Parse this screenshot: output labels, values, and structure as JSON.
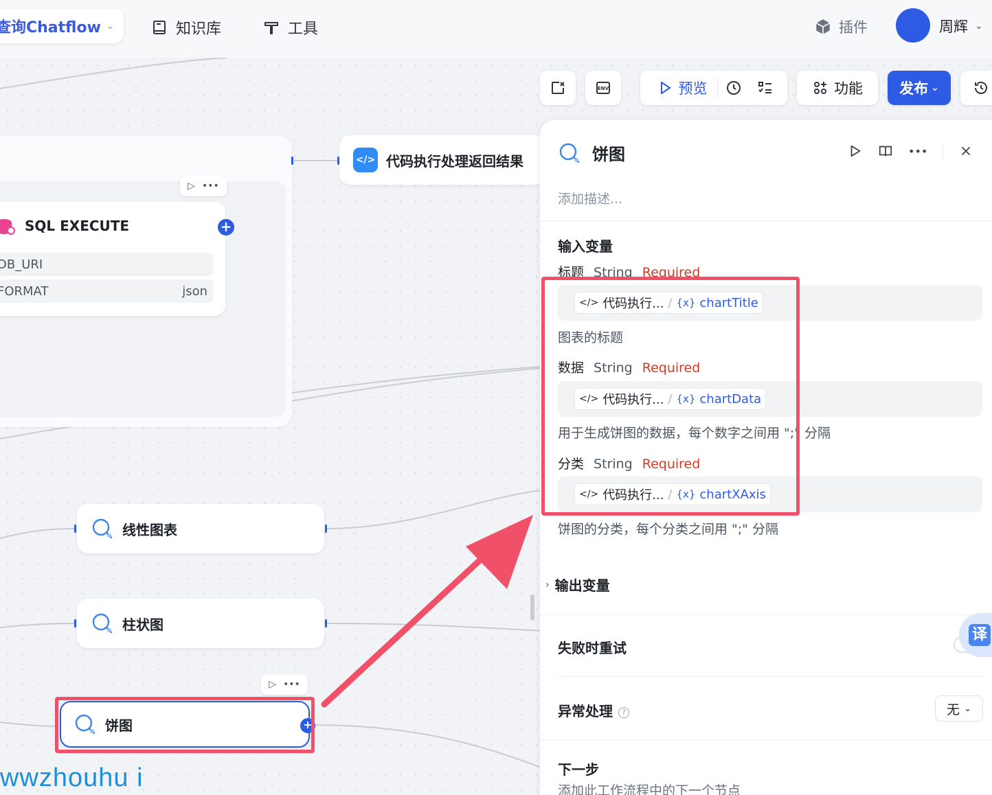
{
  "header": {
    "app_title": "查询Chatflow",
    "nav": [
      {
        "label": "知识库",
        "icon": "book-icon"
      },
      {
        "label": "工具",
        "icon": "tool-icon"
      }
    ],
    "plugins_label": "插件",
    "user_name": "周辉"
  },
  "toolbar": {
    "preview_label": "预览",
    "function_label": "功能",
    "publish_label": "发布"
  },
  "canvas": {
    "sql_node": {
      "title": "SQL EXECUTE",
      "params": [
        {
          "name": "DB_URI",
          "value": ""
        },
        {
          "name": "FORMAT",
          "value": "json"
        }
      ]
    },
    "code_node_title": "代码执行处理返回结果",
    "line_chart_title": "线性图表",
    "bar_chart_title": "柱状图",
    "pie_chart_title": "饼图",
    "watermark": "wwzhouhu i"
  },
  "panel": {
    "title": "饼图",
    "description_placeholder": "添加描述...",
    "input_section_title": "输入变量",
    "inputs": [
      {
        "name": "标题",
        "type": "String",
        "required": "Required",
        "source": "代码执行...",
        "variable": "chartTitle",
        "description": "图表的标题"
      },
      {
        "name": "数据",
        "type": "String",
        "required": "Required",
        "source": "代码执行...",
        "variable": "chartData",
        "description": "用于生成饼图的数据，每个数字之间用 \";\" 分隔"
      },
      {
        "name": "分类",
        "type": "String",
        "required": "Required",
        "source": "代码执行...",
        "variable": "chartXAxis",
        "description": "饼图的分类，每个分类之间用 \";\" 分隔"
      }
    ],
    "output_section_title": "输出变量",
    "retry_title": "失败时重试",
    "error_title": "异常处理",
    "error_value": "无",
    "next_title": "下一步",
    "next_desc": "添加此工作流程中的下一个节点",
    "translate_label": "译"
  },
  "colors": {
    "accent": "#2d5be3",
    "required": "#d23c25",
    "highlight": "#f05068"
  }
}
